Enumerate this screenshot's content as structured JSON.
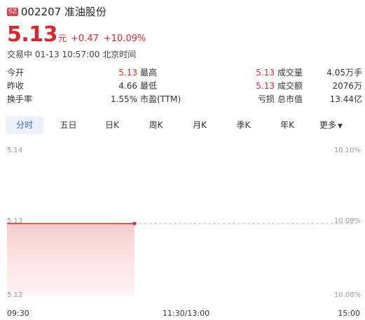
{
  "stock": {
    "market": "SZ",
    "title": "002207 准油股份",
    "price": "5.13",
    "unit": "元",
    "change": "+0.47",
    "change_pct": "+10.09%",
    "status": "交易中 01-13 10:57:00 北京时间"
  },
  "stats": [
    [
      {
        "label": "今开",
        "value": "5.13",
        "red": true
      },
      {
        "label": "最高",
        "value": "5.13",
        "red": true
      },
      {
        "label": "成交量",
        "value": "4.05万手",
        "red": false
      }
    ],
    [
      {
        "label": "昨收",
        "value": "4.66",
        "red": false
      },
      {
        "label": "最低",
        "value": "5.13",
        "red": true
      },
      {
        "label": "成交额",
        "value": "2076万",
        "red": false
      }
    ],
    [
      {
        "label": "换手率",
        "value": "1.55%",
        "red": false
      },
      {
        "label": "市盈(TTM)",
        "value": "亏损",
        "red": false
      },
      {
        "label": "总市值",
        "value": "13.44亿",
        "red": false
      }
    ]
  ],
  "tabs": {
    "t0": "分时",
    "t1": "五日",
    "t2": "日K",
    "t3": "周K",
    "t4": "月K",
    "t5": "季K",
    "t6": "年K",
    "t7": "更多"
  },
  "colors": {
    "up": "#e0242c",
    "accent": "#2f6ad1",
    "tab_bg": "#eaf1fb"
  },
  "icons": {
    "more": "chevron-down-icon"
  },
  "chart_data": {
    "type": "area",
    "y_left_labels": {
      "top": "5.14",
      "mid": "5.13",
      "bottom": "5.12"
    },
    "y_right_labels": {
      "top": "10.10%",
      "mid": "10.09%",
      "bottom": "10.08%"
    },
    "x_labels": {
      "start": "09:30",
      "mid": "11:30/13:00",
      "end": "15:00"
    },
    "ylim": [
      5.12,
      5.14
    ],
    "prev_close_line": 5.13,
    "session_minutes": 240,
    "elapsed_minutes": 87,
    "series": [
      {
        "values": [
          5.13,
          5.13
        ]
      }
    ]
  }
}
